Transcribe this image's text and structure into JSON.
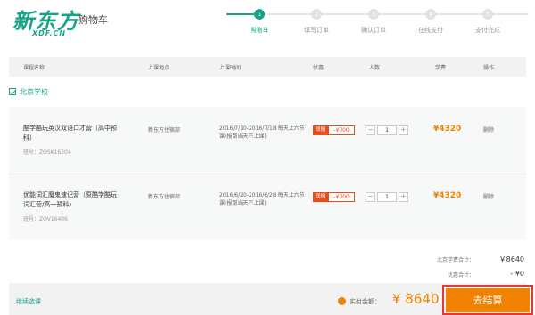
{
  "brand": {
    "logo_cn": "新东方",
    "logo_en": "XDF.CN",
    "page_name": "购物车"
  },
  "steps": [
    {
      "num": "1",
      "label": "购物车",
      "active": true
    },
    {
      "num": "2",
      "label": "填写订单",
      "active": false
    },
    {
      "num": "3",
      "label": "确认订单",
      "active": false
    },
    {
      "num": "4",
      "label": "在线支付",
      "active": false
    },
    {
      "num": "5",
      "label": "支付完成",
      "active": false
    }
  ],
  "table_header": {
    "course_name": "课程名称",
    "place": "上课地点",
    "time": "上课时间",
    "discount": "优惠",
    "count": "人数",
    "fee": "学费",
    "action": "操作"
  },
  "school": {
    "name": "北京学校",
    "checked": true
  },
  "items": [
    {
      "name": "酷学酷玩英汉双语口才营（高中预科）",
      "code": "班号：ZOSK16204",
      "place": "新东方住宿部",
      "time": "2016/7/10-2016/7/18 每天上六节课(报到当天不上课)",
      "promo_tag": "联报",
      "promo_value": "-¥700",
      "quantity": "1",
      "price": "¥4320",
      "delete": "删除"
    },
    {
      "name": "优能词汇魔鬼速记营（原酷学酷玩词汇营/高一预科）",
      "code": "班号：ZOV16406",
      "place": "新东方住宿部",
      "time": "2016/6/20-2016/6/28 每天上六节课(报到当天不上课)",
      "promo_tag": "联报",
      "promo_value": "-¥700",
      "quantity": "1",
      "price": "¥4320",
      "delete": "删除"
    }
  ],
  "summary": {
    "subtotal_label": "北京学费合计：",
    "subtotal_value": "￥8640",
    "discount_label": "优惠合计：",
    "discount_value": "- ¥0"
  },
  "footer": {
    "continue_label": "继续选课",
    "pay_label": "实付金额：",
    "pay_amount": "¥ 8640",
    "checkout_label": "去结算"
  },
  "colors": {
    "brand": "#17a589",
    "accent": "#f08200",
    "promo": "#e84d1c",
    "highlight": "#e53935"
  }
}
